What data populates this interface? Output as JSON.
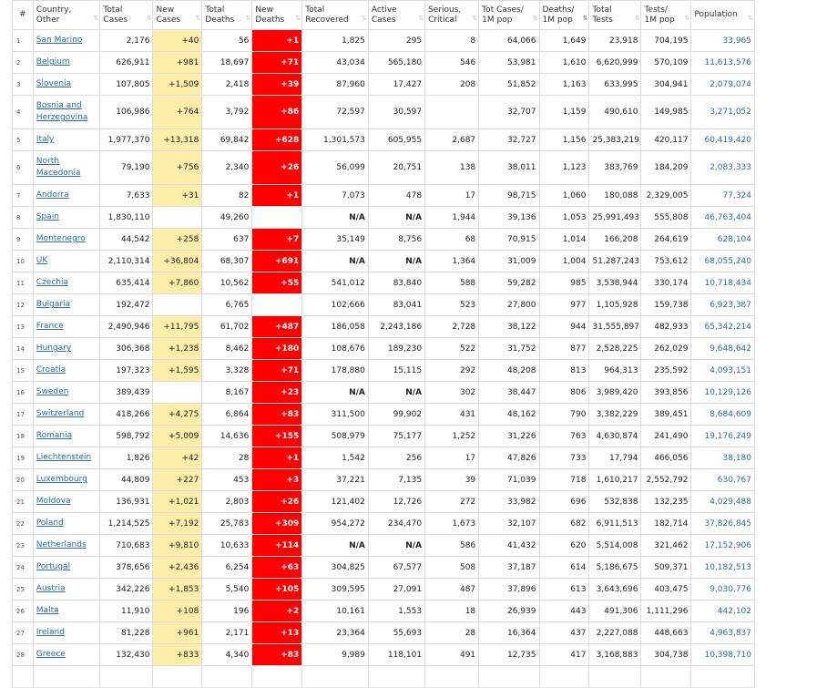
{
  "headers": {
    "rank": "#",
    "country": [
      "Country,",
      "Other"
    ],
    "total_cases": [
      "Total",
      "Cases"
    ],
    "new_cases": [
      "New",
      "Cases"
    ],
    "total_deaths": [
      "Total",
      "Deaths"
    ],
    "new_deaths": [
      "New",
      "Deaths"
    ],
    "total_recovered": [
      "Total",
      "Recovered"
    ],
    "active_cases": [
      "Active",
      "Cases"
    ],
    "serious": [
      "Serious,",
      "Critical"
    ],
    "cases_per_m": [
      "Tot Cases/",
      "1M pop"
    ],
    "deaths_per_m": [
      "Deaths/",
      "1M pop"
    ],
    "total_tests": [
      "Total",
      "Tests"
    ],
    "tests_per_m": [
      "Tests/",
      "1M pop"
    ],
    "population": [
      "Population",
      ""
    ]
  },
  "sort_icon": "sort-arrows-icon",
  "active_sort_column": "deaths_per_m",
  "colors": {
    "new_cases_bg": "#ffeeaa",
    "new_deaths_bg": "#ff0000",
    "link": "#2b6ca8"
  },
  "rows": [
    {
      "rank": "1",
      "country": "San Marino",
      "total_cases": "2,176",
      "new_cases": "+40",
      "total_deaths": "56",
      "new_deaths": "+1",
      "total_recovered": "1,825",
      "active_cases": "295",
      "serious": "8",
      "cases_per_m": "64,066",
      "deaths_per_m": "1,649",
      "total_tests": "23,918",
      "tests_per_m": "704,195",
      "population": "33,965"
    },
    {
      "rank": "2",
      "country": "Belgium",
      "total_cases": "626,911",
      "new_cases": "+981",
      "total_deaths": "18,697",
      "new_deaths": "+71",
      "total_recovered": "43,034",
      "active_cases": "565,180",
      "serious": "546",
      "cases_per_m": "53,981",
      "deaths_per_m": "1,610",
      "total_tests": "6,620,999",
      "tests_per_m": "570,109",
      "population": "11,613,576"
    },
    {
      "rank": "3",
      "country": "Slovenia",
      "total_cases": "107,805",
      "new_cases": "+1,509",
      "total_deaths": "2,418",
      "new_deaths": "+39",
      "total_recovered": "87,960",
      "active_cases": "17,427",
      "serious": "208",
      "cases_per_m": "51,852",
      "deaths_per_m": "1,163",
      "total_tests": "633,995",
      "tests_per_m": "304,941",
      "population": "2,079,074"
    },
    {
      "rank": "4",
      "country": "Bosnia and Herzegovina",
      "total_cases": "106,986",
      "new_cases": "+764",
      "total_deaths": "3,792",
      "new_deaths": "+86",
      "total_recovered": "72,597",
      "active_cases": "30,597",
      "serious": "",
      "cases_per_m": "32,707",
      "deaths_per_m": "1,159",
      "total_tests": "490,610",
      "tests_per_m": "149,985",
      "population": "3,271,052"
    },
    {
      "rank": "5",
      "country": "Italy",
      "total_cases": "1,977,370",
      "new_cases": "+13,318",
      "total_deaths": "69,842",
      "new_deaths": "+628",
      "total_recovered": "1,301,573",
      "active_cases": "605,955",
      "serious": "2,687",
      "cases_per_m": "32,727",
      "deaths_per_m": "1,156",
      "total_tests": "25,383,219",
      "tests_per_m": "420,117",
      "population": "60,419,420"
    },
    {
      "rank": "6",
      "country": "North Macedonia",
      "total_cases": "79,190",
      "new_cases": "+756",
      "total_deaths": "2,340",
      "new_deaths": "+26",
      "total_recovered": "56,099",
      "active_cases": "20,751",
      "serious": "138",
      "cases_per_m": "38,011",
      "deaths_per_m": "1,123",
      "total_tests": "383,769",
      "tests_per_m": "184,209",
      "population": "2,083,333"
    },
    {
      "rank": "7",
      "country": "Andorra",
      "total_cases": "7,633",
      "new_cases": "+31",
      "total_deaths": "82",
      "new_deaths": "+1",
      "total_recovered": "7,073",
      "active_cases": "478",
      "serious": "17",
      "cases_per_m": "98,715",
      "deaths_per_m": "1,060",
      "total_tests": "180,088",
      "tests_per_m": "2,329,005",
      "population": "77,324"
    },
    {
      "rank": "8",
      "country": "Spain",
      "total_cases": "1,830,110",
      "new_cases": "",
      "total_deaths": "49,260",
      "new_deaths": "",
      "total_recovered": "N/A",
      "active_cases": "N/A",
      "serious": "1,944",
      "cases_per_m": "39,136",
      "deaths_per_m": "1,053",
      "total_tests": "25,991,493",
      "tests_per_m": "555,808",
      "population": "46,763,404"
    },
    {
      "rank": "9",
      "country": "Montenegro",
      "total_cases": "44,542",
      "new_cases": "+258",
      "total_deaths": "637",
      "new_deaths": "+7",
      "total_recovered": "35,149",
      "active_cases": "8,756",
      "serious": "68",
      "cases_per_m": "70,915",
      "deaths_per_m": "1,014",
      "total_tests": "166,208",
      "tests_per_m": "264,619",
      "population": "628,104"
    },
    {
      "rank": "10",
      "country": "UK",
      "total_cases": "2,110,314",
      "new_cases": "+36,804",
      "total_deaths": "68,307",
      "new_deaths": "+691",
      "total_recovered": "N/A",
      "active_cases": "N/A",
      "serious": "1,364",
      "cases_per_m": "31,009",
      "deaths_per_m": "1,004",
      "total_tests": "51,287,243",
      "tests_per_m": "753,612",
      "population": "68,055,240"
    },
    {
      "rank": "11",
      "country": "Czechia",
      "total_cases": "635,414",
      "new_cases": "+7,860",
      "total_deaths": "10,562",
      "new_deaths": "+55",
      "total_recovered": "541,012",
      "active_cases": "83,840",
      "serious": "588",
      "cases_per_m": "59,282",
      "deaths_per_m": "985",
      "total_tests": "3,538,944",
      "tests_per_m": "330,174",
      "population": "10,718,434"
    },
    {
      "rank": "12",
      "country": "Bulgaria",
      "total_cases": "192,472",
      "new_cases": "",
      "total_deaths": "6,765",
      "new_deaths": "",
      "total_recovered": "102,666",
      "active_cases": "83,041",
      "serious": "523",
      "cases_per_m": "27,800",
      "deaths_per_m": "977",
      "total_tests": "1,105,928",
      "tests_per_m": "159,738",
      "population": "6,923,387"
    },
    {
      "rank": "13",
      "country": "France",
      "total_cases": "2,490,946",
      "new_cases": "+11,795",
      "total_deaths": "61,702",
      "new_deaths": "+487",
      "total_recovered": "186,058",
      "active_cases": "2,243,186",
      "serious": "2,728",
      "cases_per_m": "38,122",
      "deaths_per_m": "944",
      "total_tests": "31,555,897",
      "tests_per_m": "482,933",
      "population": "65,342,214"
    },
    {
      "rank": "14",
      "country": "Hungary",
      "total_cases": "306,368",
      "new_cases": "+1,238",
      "total_deaths": "8,462",
      "new_deaths": "+180",
      "total_recovered": "108,676",
      "active_cases": "189,230",
      "serious": "522",
      "cases_per_m": "31,752",
      "deaths_per_m": "877",
      "total_tests": "2,528,225",
      "tests_per_m": "262,029",
      "population": "9,648,642"
    },
    {
      "rank": "15",
      "country": "Croatia",
      "total_cases": "197,323",
      "new_cases": "+1,595",
      "total_deaths": "3,328",
      "new_deaths": "+71",
      "total_recovered": "178,880",
      "active_cases": "15,115",
      "serious": "292",
      "cases_per_m": "48,208",
      "deaths_per_m": "813",
      "total_tests": "964,313",
      "tests_per_m": "235,592",
      "population": "4,093,151"
    },
    {
      "rank": "16",
      "country": "Sweden",
      "total_cases": "389,439",
      "new_cases": "",
      "total_deaths": "8,167",
      "new_deaths": "+23",
      "total_recovered": "N/A",
      "active_cases": "N/A",
      "serious": "302",
      "cases_per_m": "38,447",
      "deaths_per_m": "806",
      "total_tests": "3,989,420",
      "tests_per_m": "393,856",
      "population": "10,129,126"
    },
    {
      "rank": "17",
      "country": "Switzerland",
      "total_cases": "418,266",
      "new_cases": "+4,275",
      "total_deaths": "6,864",
      "new_deaths": "+83",
      "total_recovered": "311,500",
      "active_cases": "99,902",
      "serious": "431",
      "cases_per_m": "48,162",
      "deaths_per_m": "790",
      "total_tests": "3,382,229",
      "tests_per_m": "389,451",
      "population": "8,684,609"
    },
    {
      "rank": "18",
      "country": "Romania",
      "total_cases": "598,792",
      "new_cases": "+5,009",
      "total_deaths": "14,636",
      "new_deaths": "+155",
      "total_recovered": "508,979",
      "active_cases": "75,177",
      "serious": "1,252",
      "cases_per_m": "31,226",
      "deaths_per_m": "763",
      "total_tests": "4,630,874",
      "tests_per_m": "241,490",
      "population": "19,176,249"
    },
    {
      "rank": "19",
      "country": "Liechtenstein",
      "total_cases": "1,826",
      "new_cases": "+42",
      "total_deaths": "28",
      "new_deaths": "+1",
      "total_recovered": "1,542",
      "active_cases": "256",
      "serious": "17",
      "cases_per_m": "47,826",
      "deaths_per_m": "733",
      "total_tests": "17,794",
      "tests_per_m": "466,056",
      "population": "38,180"
    },
    {
      "rank": "20",
      "country": "Luxembourg",
      "total_cases": "44,809",
      "new_cases": "+227",
      "total_deaths": "453",
      "new_deaths": "+3",
      "total_recovered": "37,221",
      "active_cases": "7,135",
      "serious": "39",
      "cases_per_m": "71,039",
      "deaths_per_m": "718",
      "total_tests": "1,610,217",
      "tests_per_m": "2,552,792",
      "population": "630,767"
    },
    {
      "rank": "21",
      "country": "Moldova",
      "total_cases": "136,931",
      "new_cases": "+1,021",
      "total_deaths": "2,803",
      "new_deaths": "+26",
      "total_recovered": "121,402",
      "active_cases": "12,726",
      "serious": "272",
      "cases_per_m": "33,982",
      "deaths_per_m": "696",
      "total_tests": "532,838",
      "tests_per_m": "132,235",
      "population": "4,029,488"
    },
    {
      "rank": "22",
      "country": "Poland",
      "total_cases": "1,214,525",
      "new_cases": "+7,192",
      "total_deaths": "25,783",
      "new_deaths": "+309",
      "total_recovered": "954,272",
      "active_cases": "234,470",
      "serious": "1,673",
      "cases_per_m": "32,107",
      "deaths_per_m": "682",
      "total_tests": "6,911,513",
      "tests_per_m": "182,714",
      "population": "37,826,845"
    },
    {
      "rank": "23",
      "country": "Netherlands",
      "total_cases": "710,683",
      "new_cases": "+9,810",
      "total_deaths": "10,633",
      "new_deaths": "+114",
      "total_recovered": "N/A",
      "active_cases": "N/A",
      "serious": "586",
      "cases_per_m": "41,432",
      "deaths_per_m": "620",
      "total_tests": "5,514,008",
      "tests_per_m": "321,462",
      "population": "17,152,906"
    },
    {
      "rank": "24",
      "country": "Portugal",
      "total_cases": "378,656",
      "new_cases": "+2,436",
      "total_deaths": "6,254",
      "new_deaths": "+63",
      "total_recovered": "304,825",
      "active_cases": "67,577",
      "serious": "508",
      "cases_per_m": "37,187",
      "deaths_per_m": "614",
      "total_tests": "5,186,675",
      "tests_per_m": "509,371",
      "population": "10,182,513"
    },
    {
      "rank": "25",
      "country": "Austria",
      "total_cases": "342,226",
      "new_cases": "+1,853",
      "total_deaths": "5,540",
      "new_deaths": "+105",
      "total_recovered": "309,595",
      "active_cases": "27,091",
      "serious": "487",
      "cases_per_m": "37,896",
      "deaths_per_m": "613",
      "total_tests": "3,643,696",
      "tests_per_m": "403,475",
      "population": "9,030,776"
    },
    {
      "rank": "26",
      "country": "Malta",
      "total_cases": "11,910",
      "new_cases": "+108",
      "total_deaths": "196",
      "new_deaths": "+2",
      "total_recovered": "10,161",
      "active_cases": "1,553",
      "serious": "18",
      "cases_per_m": "26,939",
      "deaths_per_m": "443",
      "total_tests": "491,306",
      "tests_per_m": "1,111,296",
      "population": "442,102"
    },
    {
      "rank": "27",
      "country": "Ireland",
      "total_cases": "81,228",
      "new_cases": "+961",
      "total_deaths": "2,171",
      "new_deaths": "+13",
      "total_recovered": "23,364",
      "active_cases": "55,693",
      "serious": "28",
      "cases_per_m": "16,364",
      "deaths_per_m": "437",
      "total_tests": "2,227,088",
      "tests_per_m": "448,663",
      "population": "4,963,837"
    },
    {
      "rank": "28",
      "country": "Greece",
      "total_cases": "132,430",
      "new_cases": "+833",
      "total_deaths": "4,340",
      "new_deaths": "+83",
      "total_recovered": "9,989",
      "active_cases": "118,101",
      "serious": "491",
      "cases_per_m": "12,735",
      "deaths_per_m": "417",
      "total_tests": "3,168,883",
      "tests_per_m": "304,738",
      "population": "10,398,710"
    },
    {
      "rank": "",
      "country": "",
      "total_cases": "",
      "new_cases": "",
      "total_deaths": "",
      "new_deaths": "",
      "total_recovered": "",
      "active_cases": "",
      "serious": "",
      "cases_per_m": "",
      "deaths_per_m": "",
      "total_tests": "",
      "tests_per_m": "",
      "population": ""
    }
  ]
}
